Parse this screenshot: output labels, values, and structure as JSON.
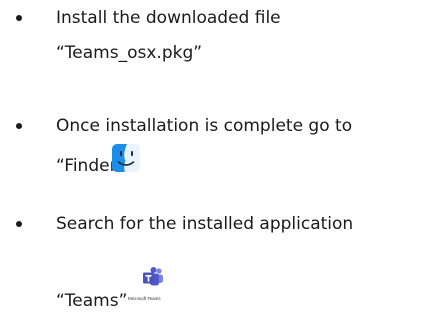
{
  "steps": [
    {
      "line1": "Install the downloaded file",
      "line2": "“Teams_osx.pkg”"
    },
    {
      "line1": "Once installation is complete go to",
      "line2": "“Finder”",
      "icon": "finder-icon"
    },
    {
      "line1": "Search for the installed application",
      "line2": "“Teams”",
      "icon": "microsoft-teams-icon",
      "icon_caption": "Microsoft Teams"
    }
  ],
  "colors": {
    "text": "#1a1a1a",
    "finder_blue": "#1a8ee8",
    "finder_light": "#cfe6fb",
    "teams_purple": "#5059c9",
    "teams_purple_dark": "#4b53bc"
  }
}
